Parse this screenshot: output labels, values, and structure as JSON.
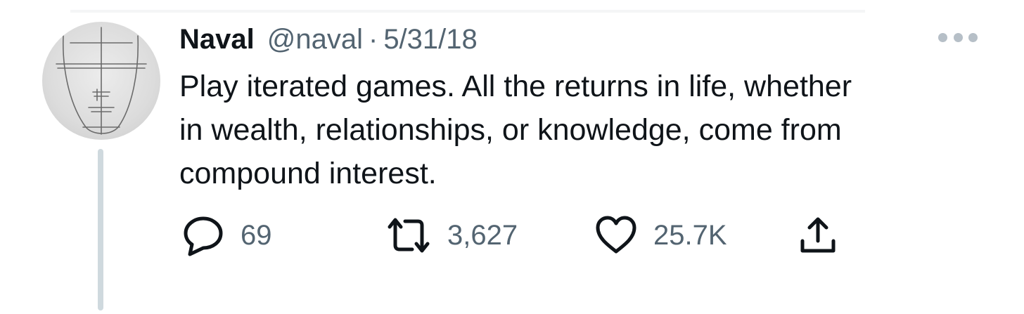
{
  "tweet": {
    "author_name": "Naval",
    "handle": "@naval",
    "separator": "·",
    "date": "5/31/18",
    "text_lines": [
      "Play iterated games. All the returns in life, whether",
      "in wealth, relationships, or knowledge, come from",
      "compound interest."
    ]
  },
  "actions": {
    "reply": {
      "icon": "reply-icon",
      "count": "69"
    },
    "retweet": {
      "icon": "retweet-icon",
      "count": "3,627"
    },
    "like": {
      "icon": "heart-icon",
      "count": "25.7K"
    },
    "share": {
      "icon": "share-icon"
    }
  },
  "colors": {
    "text": "#0f1419",
    "secondary_text": "#536471",
    "thread_line": "#cfd9de",
    "more_dots": "#b6bfc7"
  }
}
